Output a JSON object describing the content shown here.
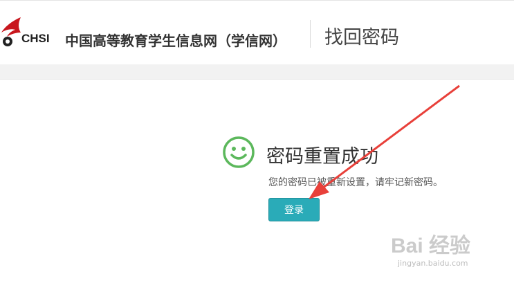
{
  "header": {
    "logo_text": "CHSI",
    "site_name": "中国高等教育学生信息网（学信网）",
    "page_title": "找回密码"
  },
  "result": {
    "title": "密码重置成功",
    "description": "您的密码已被重新设置，请牢记新密码。",
    "login_button": "登录",
    "success_color": "#5cb85c"
  },
  "colors": {
    "button": "#2aabb8",
    "arrow": "#e8403a"
  },
  "watermark": {
    "logo": "Bai 经验",
    "url": "jingyan.baidu.com"
  }
}
